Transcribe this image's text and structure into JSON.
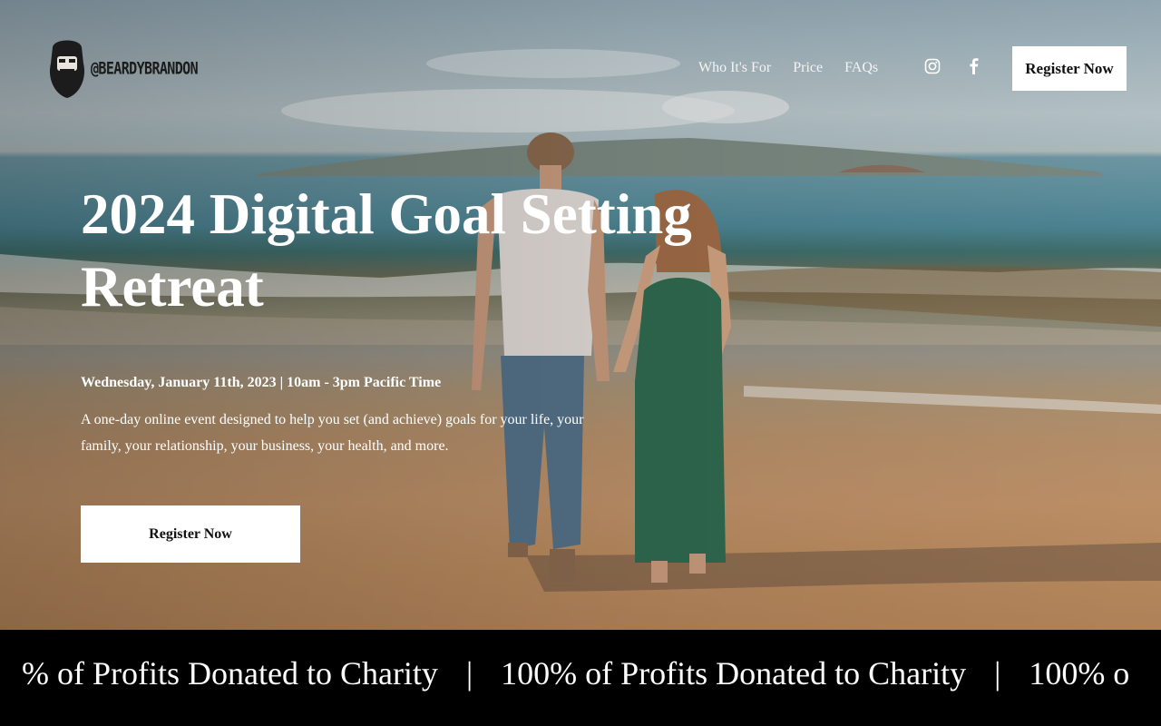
{
  "header": {
    "logo_text": "@BEARDYBRANDON",
    "nav": [
      "Who It's For",
      "Price",
      "FAQs"
    ],
    "social_icons": [
      "instagram-icon",
      "facebook-icon"
    ],
    "register_label": "Register Now"
  },
  "hero": {
    "title": "2024 Digital Goal Setting Retreat",
    "date_line": "Wednesday, January 11th, 2023 |  10am - 3pm Pacific Time",
    "description": "A one-day online event designed to help you set (and achieve) goals for your life, your family, your relationship, your business, your health, and more.",
    "register_label": "Register Now"
  },
  "marquee": {
    "items": [
      "% of Profits Donated to Charity",
      "100% of Profits Donated to Charity",
      "100% o"
    ],
    "separator": "|"
  },
  "colors": {
    "text_light": "#ffffff",
    "button_bg": "#ffffff",
    "marquee_bg": "#000000"
  }
}
